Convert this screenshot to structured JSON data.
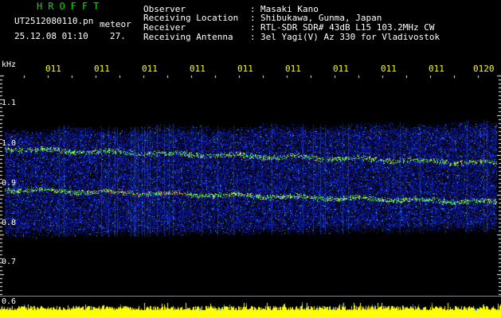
{
  "header": {
    "app_title": "HROFFT",
    "file_name": "UT2512080110.pn",
    "meteor_word": "meteor",
    "date_time": "25.12.08 01:10",
    "count": "27.",
    "info": [
      {
        "label": "Observer",
        "value": "Masaki Kano"
      },
      {
        "label": "Receiving Location",
        "value": "Shibukawa, Gunma, Japan"
      },
      {
        "label": "Receiver",
        "value": "RTL-SDR SDR# 43dB L15 103.2MHz CW"
      },
      {
        "label": "Receiving Antenna",
        "value": "3el Yagi(V) Az 330 for Vladivostok"
      }
    ]
  },
  "axis": {
    "unit": "kHz",
    "time_ticks": [
      "011",
      "011",
      "011",
      "011",
      "011",
      "011",
      "011",
      "011",
      "011",
      "0120"
    ],
    "freq_labels": [
      "1.1",
      "1.0",
      "0.9",
      "0.8",
      "0.7",
      "0.6"
    ]
  },
  "colors": {
    "title": "#00e000",
    "tick": "#ffff00",
    "noise_blue": "#1020c0",
    "signal_green": "#40ff60",
    "signal_red": "#ff3020",
    "baseline": "#ffff00"
  }
}
